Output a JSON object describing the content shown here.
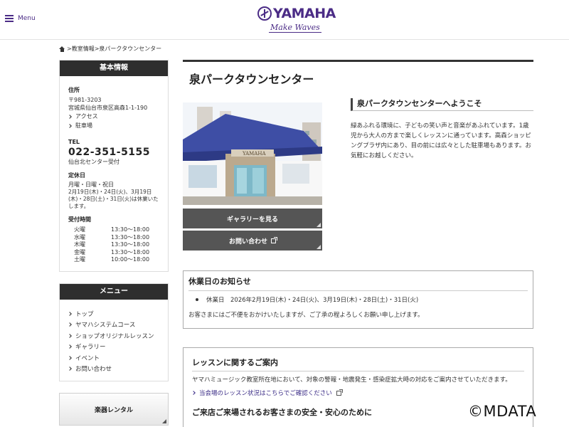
{
  "header": {
    "menu_label": "Menu",
    "logo_text": "YAMAHA",
    "logo_tagline": "Make Waves"
  },
  "breadcrumb": {
    "sep1": ">",
    "item1": "教室情報",
    "sep2": ">",
    "current": "泉パークタウンセンター"
  },
  "sidebar": {
    "info_title": "基本情報",
    "address_label": "住所",
    "postal": "〒981-3203",
    "address": "宮城県仙台市泉区高森1-1-190",
    "access_link": "アクセス",
    "parking_link": "駐車場",
    "tel_label": "TEL",
    "tel": "022-351-5155",
    "tel_note": "仙台北センター受付",
    "closed_label": "定休日",
    "closed_days": "月曜・日曜・祝日",
    "closed_note": "2月19日(木)・24日(火)、3月19日(木)・28日(土)・31日(火)は休業いたします。",
    "hours_label": "受付時間",
    "hours": [
      {
        "day": "火曜",
        "time": "13:30～18:00"
      },
      {
        "day": "水曜",
        "time": "13:30～18:00"
      },
      {
        "day": "木曜",
        "time": "13:30～18:00"
      },
      {
        "day": "金曜",
        "time": "13:30～18:00"
      },
      {
        "day": "土曜",
        "time": "10:00～18:00"
      }
    ],
    "menu_title": "メニュー",
    "menu_items": [
      "トップ",
      "ヤマハシステムコース",
      "ショップオリジナルレッスン",
      "ギャラリー",
      "イベント",
      "お問い合わせ"
    ],
    "rental_label": "楽器レンタル"
  },
  "main": {
    "title": "泉パークタウンセンター",
    "photo_sign": "YAMAHA",
    "gallery_button": "ギャラリーを見る",
    "contact_button": "お問い合わせ",
    "welcome_title": "泉パークタウンセンターへようこそ",
    "welcome_text": "緑あふれる環境に、子どもの笑い声と音楽があふれています。1歳児から大人の方まで楽しくレッスンに通っています。高森ショッピングプラザ内にあり、目の前には広々とした駐車場もあります。お気軽にお越しください。",
    "notice_title": "休業日のお知らせ",
    "notice_item": "休業日　2026年2月19日(木)・24日(火)、3月19日(木)・28日(土)・31日(火)",
    "notice_text": "お客さまにはご不便をおかけいたしますが、ご了承の程よろしくお願い申し上げます。",
    "lesson_title": "レッスンに関するご案内",
    "lesson_text": "ヤマハミュージック教室所在地において、対象の警報・地震発生・感染症拡大時の対応をご案内させていただきます。",
    "lesson_link": "当会場のレッスン状況はこちらでご確認ください",
    "lesson_sub": "ご来店ご来場されるお客さまの安全・安心のために"
  },
  "watermark": "©MDATA",
  "colors": {
    "brand": "#4b2c86",
    "dark_header": "#2e2e2e",
    "button_gray": "#555555"
  }
}
